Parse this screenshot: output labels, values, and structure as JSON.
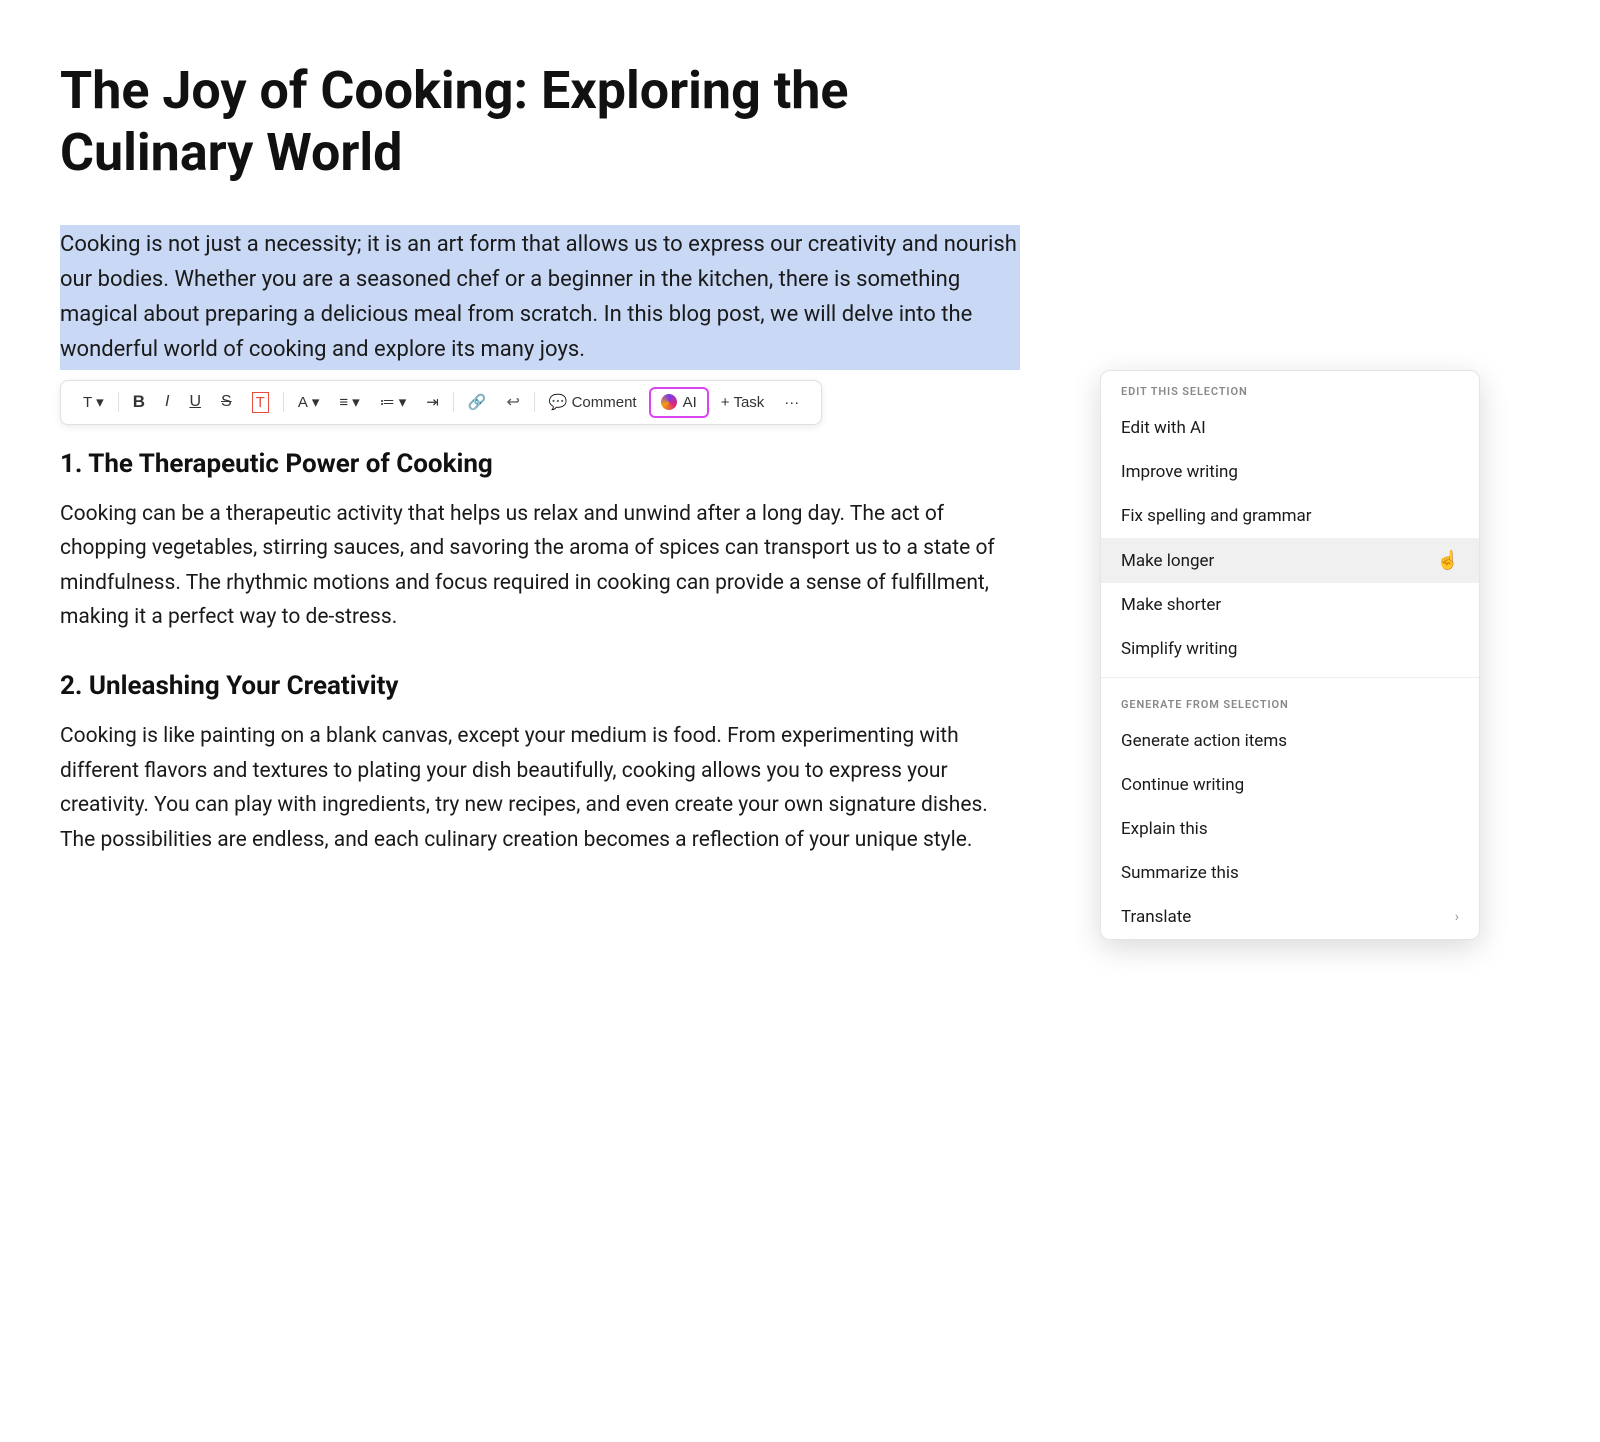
{
  "document": {
    "title": "The Joy of Cooking: Exploring the Culinary World",
    "selected_paragraph": "Cooking is not just a necessity; it is an art form that allows us to express our creativity and nourish our bodies. Whether you are a seasoned chef or a beginner in the kitchen, there is something magical about preparing a delicious meal from scratch. In this blog post, we will delve into the wonderful world of cooking and explore its many joys.",
    "section1": {
      "heading": "1. The Therapeutic Power of Cooking",
      "text": "Cooking can be a therapeutic activity that helps us relax and unwind after a long day. The act of chopping vegetables, stirring sauces, and savoring the aroma of spices can transport us to a state of mindfulness. The rhythmic motions and focus required in cooking can provide a sense of fulfillment, making it a perfect way to de-stress."
    },
    "section2": {
      "heading": "2. Unleashing Your Creativity",
      "text": "Cooking is like painting on a blank canvas, except your medium is food. From experimenting with different flavors and textures to plating your dish beautifully, cooking allows you to express your creativity. You can play with ingredients, try new recipes, and even create your own signature dishes. The possibilities are endless, and each culinary creation becomes a reflection of your unique style."
    }
  },
  "toolbar": {
    "text_label": "T",
    "text_dropdown": "▾",
    "bold": "B",
    "italic": "I",
    "underline": "U",
    "strikethrough": "S",
    "highlight": "T̲",
    "font_color": "A",
    "font_color_dropdown": "▾",
    "align": "≡",
    "align_dropdown": "▾",
    "bullet": "≔",
    "bullet_dropdown": "▾",
    "indent": "⇥",
    "link": "🔗",
    "quote": "❝",
    "comment_label": "Comment",
    "ai_label": "AI",
    "task_label": "+ Task",
    "more": "···"
  },
  "ai_dropdown": {
    "edit_section_label": "EDIT THIS SELECTION",
    "edit_items": [
      {
        "id": "edit-with-ai",
        "label": "Edit with AI",
        "has_arrow": false
      },
      {
        "id": "improve-writing",
        "label": "Improve writing",
        "has_arrow": false
      },
      {
        "id": "fix-spelling",
        "label": "Fix spelling and grammar",
        "has_arrow": false
      },
      {
        "id": "make-longer",
        "label": "Make longer",
        "has_arrow": false,
        "hovered": true
      },
      {
        "id": "make-shorter",
        "label": "Make shorter",
        "has_arrow": false
      },
      {
        "id": "simplify-writing",
        "label": "Simplify writing",
        "has_arrow": false
      }
    ],
    "generate_section_label": "GENERATE FROM SELECTION",
    "generate_items": [
      {
        "id": "generate-action-items",
        "label": "Generate action items",
        "has_arrow": false
      },
      {
        "id": "continue-writing",
        "label": "Continue writing",
        "has_arrow": false
      },
      {
        "id": "explain-this",
        "label": "Explain this",
        "has_arrow": false
      },
      {
        "id": "summarize-this",
        "label": "Summarize this",
        "has_arrow": false
      },
      {
        "id": "translate",
        "label": "Translate",
        "has_arrow": true
      }
    ]
  }
}
